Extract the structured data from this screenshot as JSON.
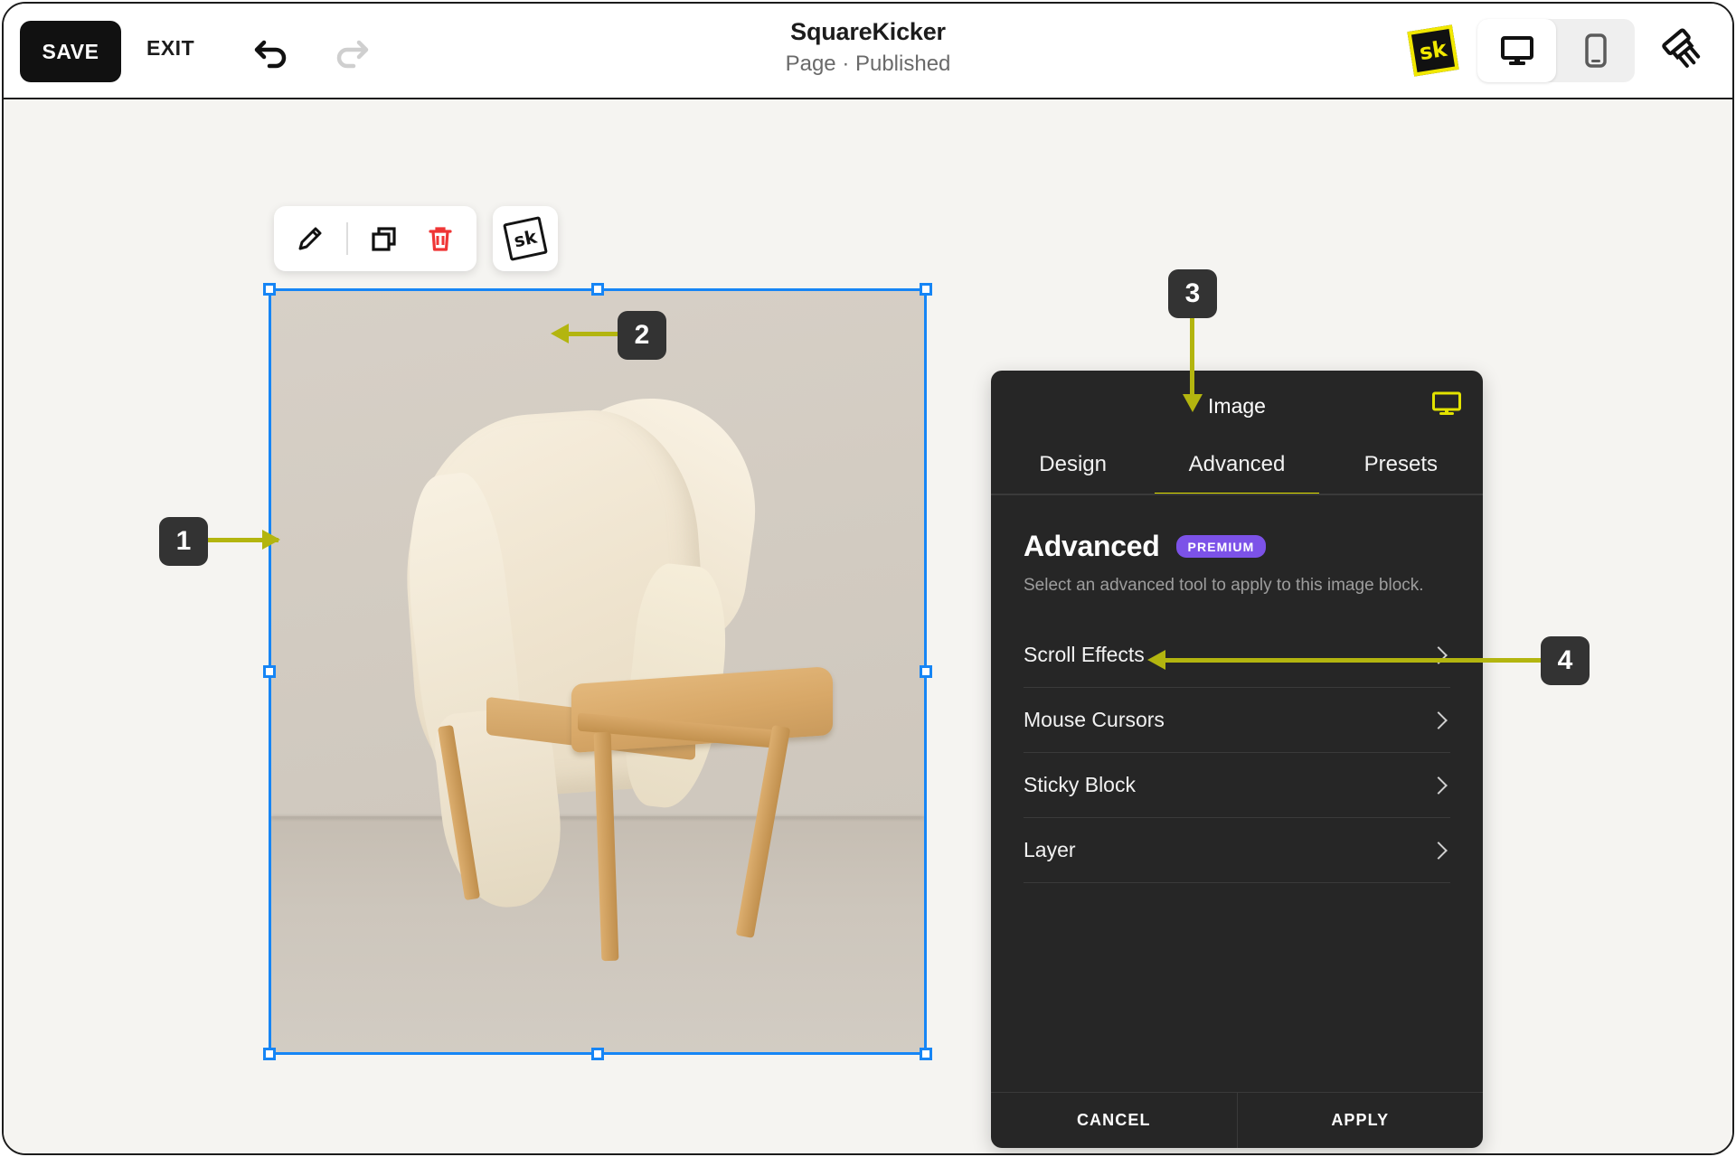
{
  "topbar": {
    "save_label": "SAVE",
    "exit_label": "EXIT",
    "undo_icon": "undo-arrow-icon",
    "redo_icon": "redo-arrow-icon",
    "title": "SquareKicker",
    "subtitle": "Page · Published",
    "logo_text": "sk",
    "device_desktop_icon": "desktop-monitor-icon",
    "device_mobile_icon": "mobile-phone-icon",
    "device_selected": "desktop",
    "brush_icon": "paintbrush-icon"
  },
  "block_toolbar": {
    "edit_icon": "pencil-icon",
    "duplicate_icon": "duplicate-icon",
    "delete_icon": "trash-icon",
    "sk_button_text": "sk"
  },
  "canvas": {
    "selected_block": "image-block",
    "selection_color": "#1685f5",
    "photo_description": "Wooden chair with cream blazer draped over it"
  },
  "panel": {
    "title": "Image",
    "device_icon": "desktop-monitor-icon",
    "tabs": [
      {
        "label": "Design",
        "active": false
      },
      {
        "label": "Advanced",
        "active": true
      },
      {
        "label": "Presets",
        "active": false
      }
    ],
    "heading": "Advanced",
    "badge": "PREMIUM",
    "badge_color": "#7c52e8",
    "description": "Select an advanced tool to apply to this image block.",
    "items": [
      {
        "label": "Scroll Effects"
      },
      {
        "label": "Mouse Cursors"
      },
      {
        "label": "Sticky Block"
      },
      {
        "label": "Layer"
      }
    ],
    "cancel_label": "CANCEL",
    "apply_label": "APPLY",
    "accent_color": "#e2e200"
  },
  "callouts": [
    {
      "number": "1"
    },
    {
      "number": "2"
    },
    {
      "number": "3"
    },
    {
      "number": "4"
    }
  ]
}
